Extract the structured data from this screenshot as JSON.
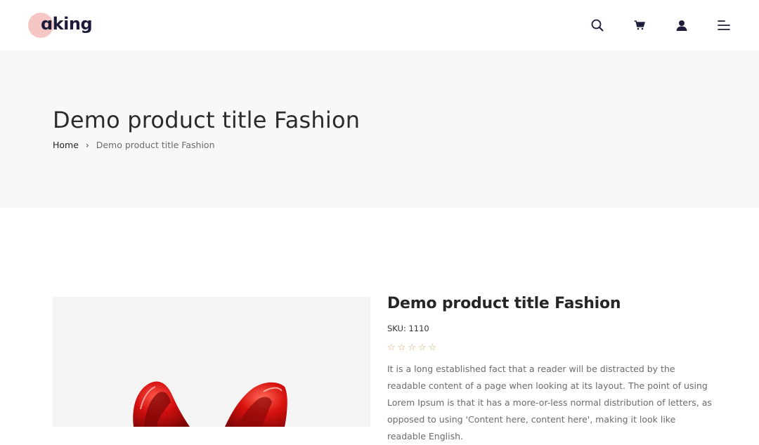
{
  "header": {
    "logo_text": "ɑking",
    "icons": {
      "search": "search-icon",
      "cart": "cart-icon",
      "account": "user-icon",
      "menu": "menu-icon"
    }
  },
  "hero": {
    "title": "Demo product title Fashion",
    "breadcrumb": {
      "home": "Home",
      "separator": "›",
      "current": "Demo product title Fashion"
    }
  },
  "product": {
    "title": "Demo product title Fashion",
    "sku": "SKU: 1110",
    "rating": {
      "stars_filled": 0,
      "stars_total": 5,
      "star_glyph": "☆"
    },
    "description": "It is a long established fact that a reader will be distracted by the readable content of a page when looking at its layout. The point of using Lorem Ipsum is that it has a more-or-less normal distribution of letters, as opposed to using 'Content here, content here', making it look like readable English."
  },
  "colors": {
    "hero_bg": "#f8f8f8",
    "logo_circle": "#f6c6c4",
    "logo_text": "#1c1c3a",
    "icon": "#1c1c3a",
    "star": "#d9a76b",
    "shoe": "#d40f0f"
  }
}
